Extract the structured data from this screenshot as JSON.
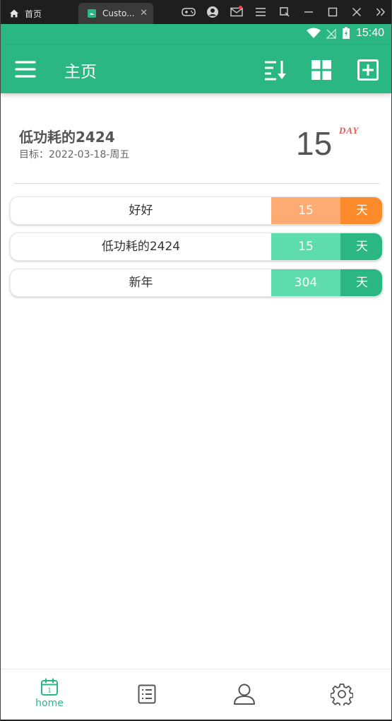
{
  "emulator": {
    "home_tab_label": "首页",
    "active_tab_label": "Custo...",
    "tab_close": "✕"
  },
  "status_bar": {
    "time": "15:40"
  },
  "app_bar": {
    "title": "主页",
    "color": "#2bb784"
  },
  "featured": {
    "title": "低功耗的2424",
    "subtitle": "目标：2022-03-18-周五",
    "count": "15",
    "unit": "DAY"
  },
  "list": [
    {
      "name": "好好",
      "count": "15",
      "unit": "天",
      "count_color": "#fdaa73",
      "unit_color": "#fa8a2a"
    },
    {
      "name": "低功耗的2424",
      "count": "15",
      "unit": "天",
      "count_color": "#5fdcae",
      "unit_color": "#2bb784"
    },
    {
      "name": "新年",
      "count": "304",
      "unit": "天",
      "count_color": "#5fdcae",
      "unit_color": "#2bb784"
    }
  ],
  "bottom_nav": {
    "home_label": "home",
    "calendar_icon_day": "1"
  }
}
